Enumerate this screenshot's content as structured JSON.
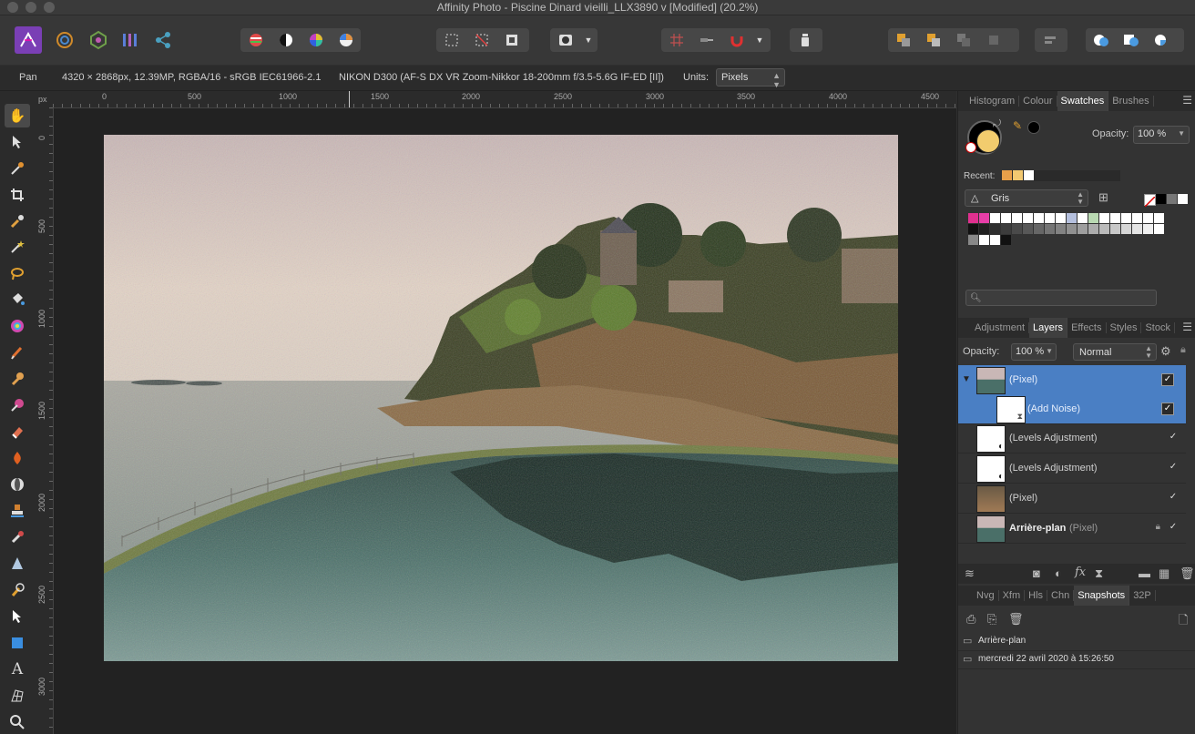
{
  "window": {
    "title": "Affinity Photo - Piscine Dinard vieilli_LLX3890 v [Modified] (20.2%)"
  },
  "toolbar": {
    "personas": [
      "photo-persona-icon",
      "liquify-persona-icon",
      "develop-persona-icon",
      "tone-mapping-persona-icon",
      "export-persona-icon"
    ],
    "accent": "#7a3fb5"
  },
  "context": {
    "tool": "Pan",
    "doc_info": "4320 × 2868px, 12.39MP, RGBA/16 - sRGB IEC61966-2.1",
    "camera": "NIKON D300 (AF-S DX VR Zoom-Nikkor 18-200mm f/3.5-5.6G IF-ED [II])",
    "units_label": "Units:",
    "units_value": "Pixels"
  },
  "rulers": {
    "unit": "px",
    "top": [
      "0",
      "500",
      "1000",
      "1500",
      "2000",
      "2500",
      "3000",
      "3500",
      "4000",
      "4500"
    ],
    "left": [
      "0",
      "500",
      "1000",
      "1500",
      "2000",
      "2500",
      "3000"
    ]
  },
  "swatches_panel": {
    "tabs": [
      "Histogram",
      "Colour",
      "Swatches",
      "Brushes"
    ],
    "active_tab": "Swatches",
    "opacity_label": "Opacity:",
    "opacity_value": "100 %",
    "recent_label": "Recent:",
    "recent_colors": [
      "#e9a04a",
      "#f2c870",
      "#ffffff"
    ],
    "palette_name": "Gris",
    "primary_color": "#000000",
    "secondary_color": "#f2cc6e",
    "palette_colors": [
      "#e0308f",
      "#e83ea8",
      "#ffffff",
      "#ffffff",
      "#ffffff",
      "#ffffff",
      "#ffffff",
      "#ffffff",
      "#ffffff",
      "#b5c0de",
      "#ffffff",
      "#b9d9b2",
      "#ffffff",
      "#ffffff",
      "#ffffff",
      "#ffffff",
      "#ffffff",
      "#ffffff",
      "#111111",
      "#202020",
      "#2e2e2e",
      "#3c3c3c",
      "#4a4a4a",
      "#585858",
      "#666666",
      "#747474",
      "#828282",
      "#909090",
      "#9e9e9e",
      "#acacac",
      "#bababa",
      "#c8c8c8",
      "#d6d6d6",
      "#e4e4e4",
      "#f0f0f0",
      "#ffffff",
      "#888888",
      "#ffffff",
      "#ffffff",
      "#111111"
    ]
  },
  "layers_panel": {
    "tabs": [
      "Adjustment",
      "Layers",
      "Effects",
      "Styles",
      "Stock"
    ],
    "active_tab": "Layers",
    "opacity_label": "Opacity:",
    "opacity_value": "100 %",
    "blend_mode": "Normal",
    "layers": [
      {
        "name": "",
        "type": "(Pixel)",
        "selected": true
      },
      {
        "name": "",
        "type": "(Add Noise)",
        "selected": true
      },
      {
        "name": "",
        "type": "(Levels Adjustment)",
        "selected": false
      },
      {
        "name": "",
        "type": "(Levels Adjustment)",
        "selected": false
      },
      {
        "name": "",
        "type": "(Pixel)",
        "selected": false
      },
      {
        "name": "Arrière-plan",
        "type": "(Pixel)",
        "selected": false
      }
    ]
  },
  "snapshots_panel": {
    "tabs": [
      "Nvg",
      "Xfm",
      "Hls",
      "Chn",
      "Snapshots",
      "32P"
    ],
    "active_tab": "Snapshots",
    "items": [
      "Arrière-plan",
      "mercredi 22 avril 2020 à 15:26:50"
    ]
  }
}
